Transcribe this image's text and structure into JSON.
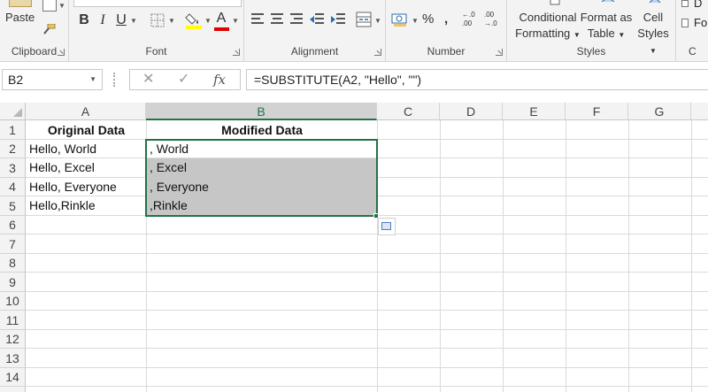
{
  "ribbon": {
    "clipboard": {
      "paste_label": "Paste",
      "group_label": "Clipboard"
    },
    "font": {
      "group_label": "Font",
      "bold": "B",
      "italic": "I",
      "underline": "U",
      "font_color_glyph": "A"
    },
    "alignment": {
      "group_label": "Alignment"
    },
    "number": {
      "group_label": "Number",
      "percent": "%",
      "comma": ",",
      "inc_decimal": "←.0\n.00",
      "dec_decimal": ".00\n→.0"
    },
    "styles": {
      "group_label": "Styles",
      "conditional_formatting_line1": "Conditional",
      "conditional_formatting_line2": "Formatting",
      "format_as_table_line1": "Format as",
      "format_as_table_line2": "Table",
      "cell_styles_line1": "Cell",
      "cell_styles_line2": "Styles"
    },
    "cells": {
      "partial1": "D",
      "partial2": "Fo",
      "group_label_partial": "C"
    }
  },
  "formula_bar": {
    "name_box": "B2",
    "cancel_glyph": "✕",
    "enter_glyph": "✓",
    "fx_label": "fx",
    "formula": "=SUBSTITUTE(A2, \"Hello\", \"\")"
  },
  "sheet": {
    "columns": [
      "A",
      "B",
      "C",
      "D",
      "E",
      "F",
      "G"
    ],
    "rows": [
      "1",
      "2",
      "3",
      "4",
      "5",
      "6",
      "7",
      "8",
      "9",
      "10",
      "11",
      "12",
      "13",
      "14"
    ],
    "cells": {
      "A1": "Original Data",
      "B1": "Modified Data",
      "A2": "Hello, World",
      "B2": ", World",
      "A3": "Hello, Excel",
      "B3": ", Excel",
      "A4": "Hello, Everyone",
      "B4": ", Everyone",
      "A5": "Hello,Rinkle",
      "B5": ",Rinkle"
    },
    "selected_column": "B",
    "selection_range": "B2:B5"
  },
  "colors": {
    "accent": "#217346",
    "selection_fill": "#c6c6c6",
    "ribbon_bg": "#f3f3f3"
  }
}
